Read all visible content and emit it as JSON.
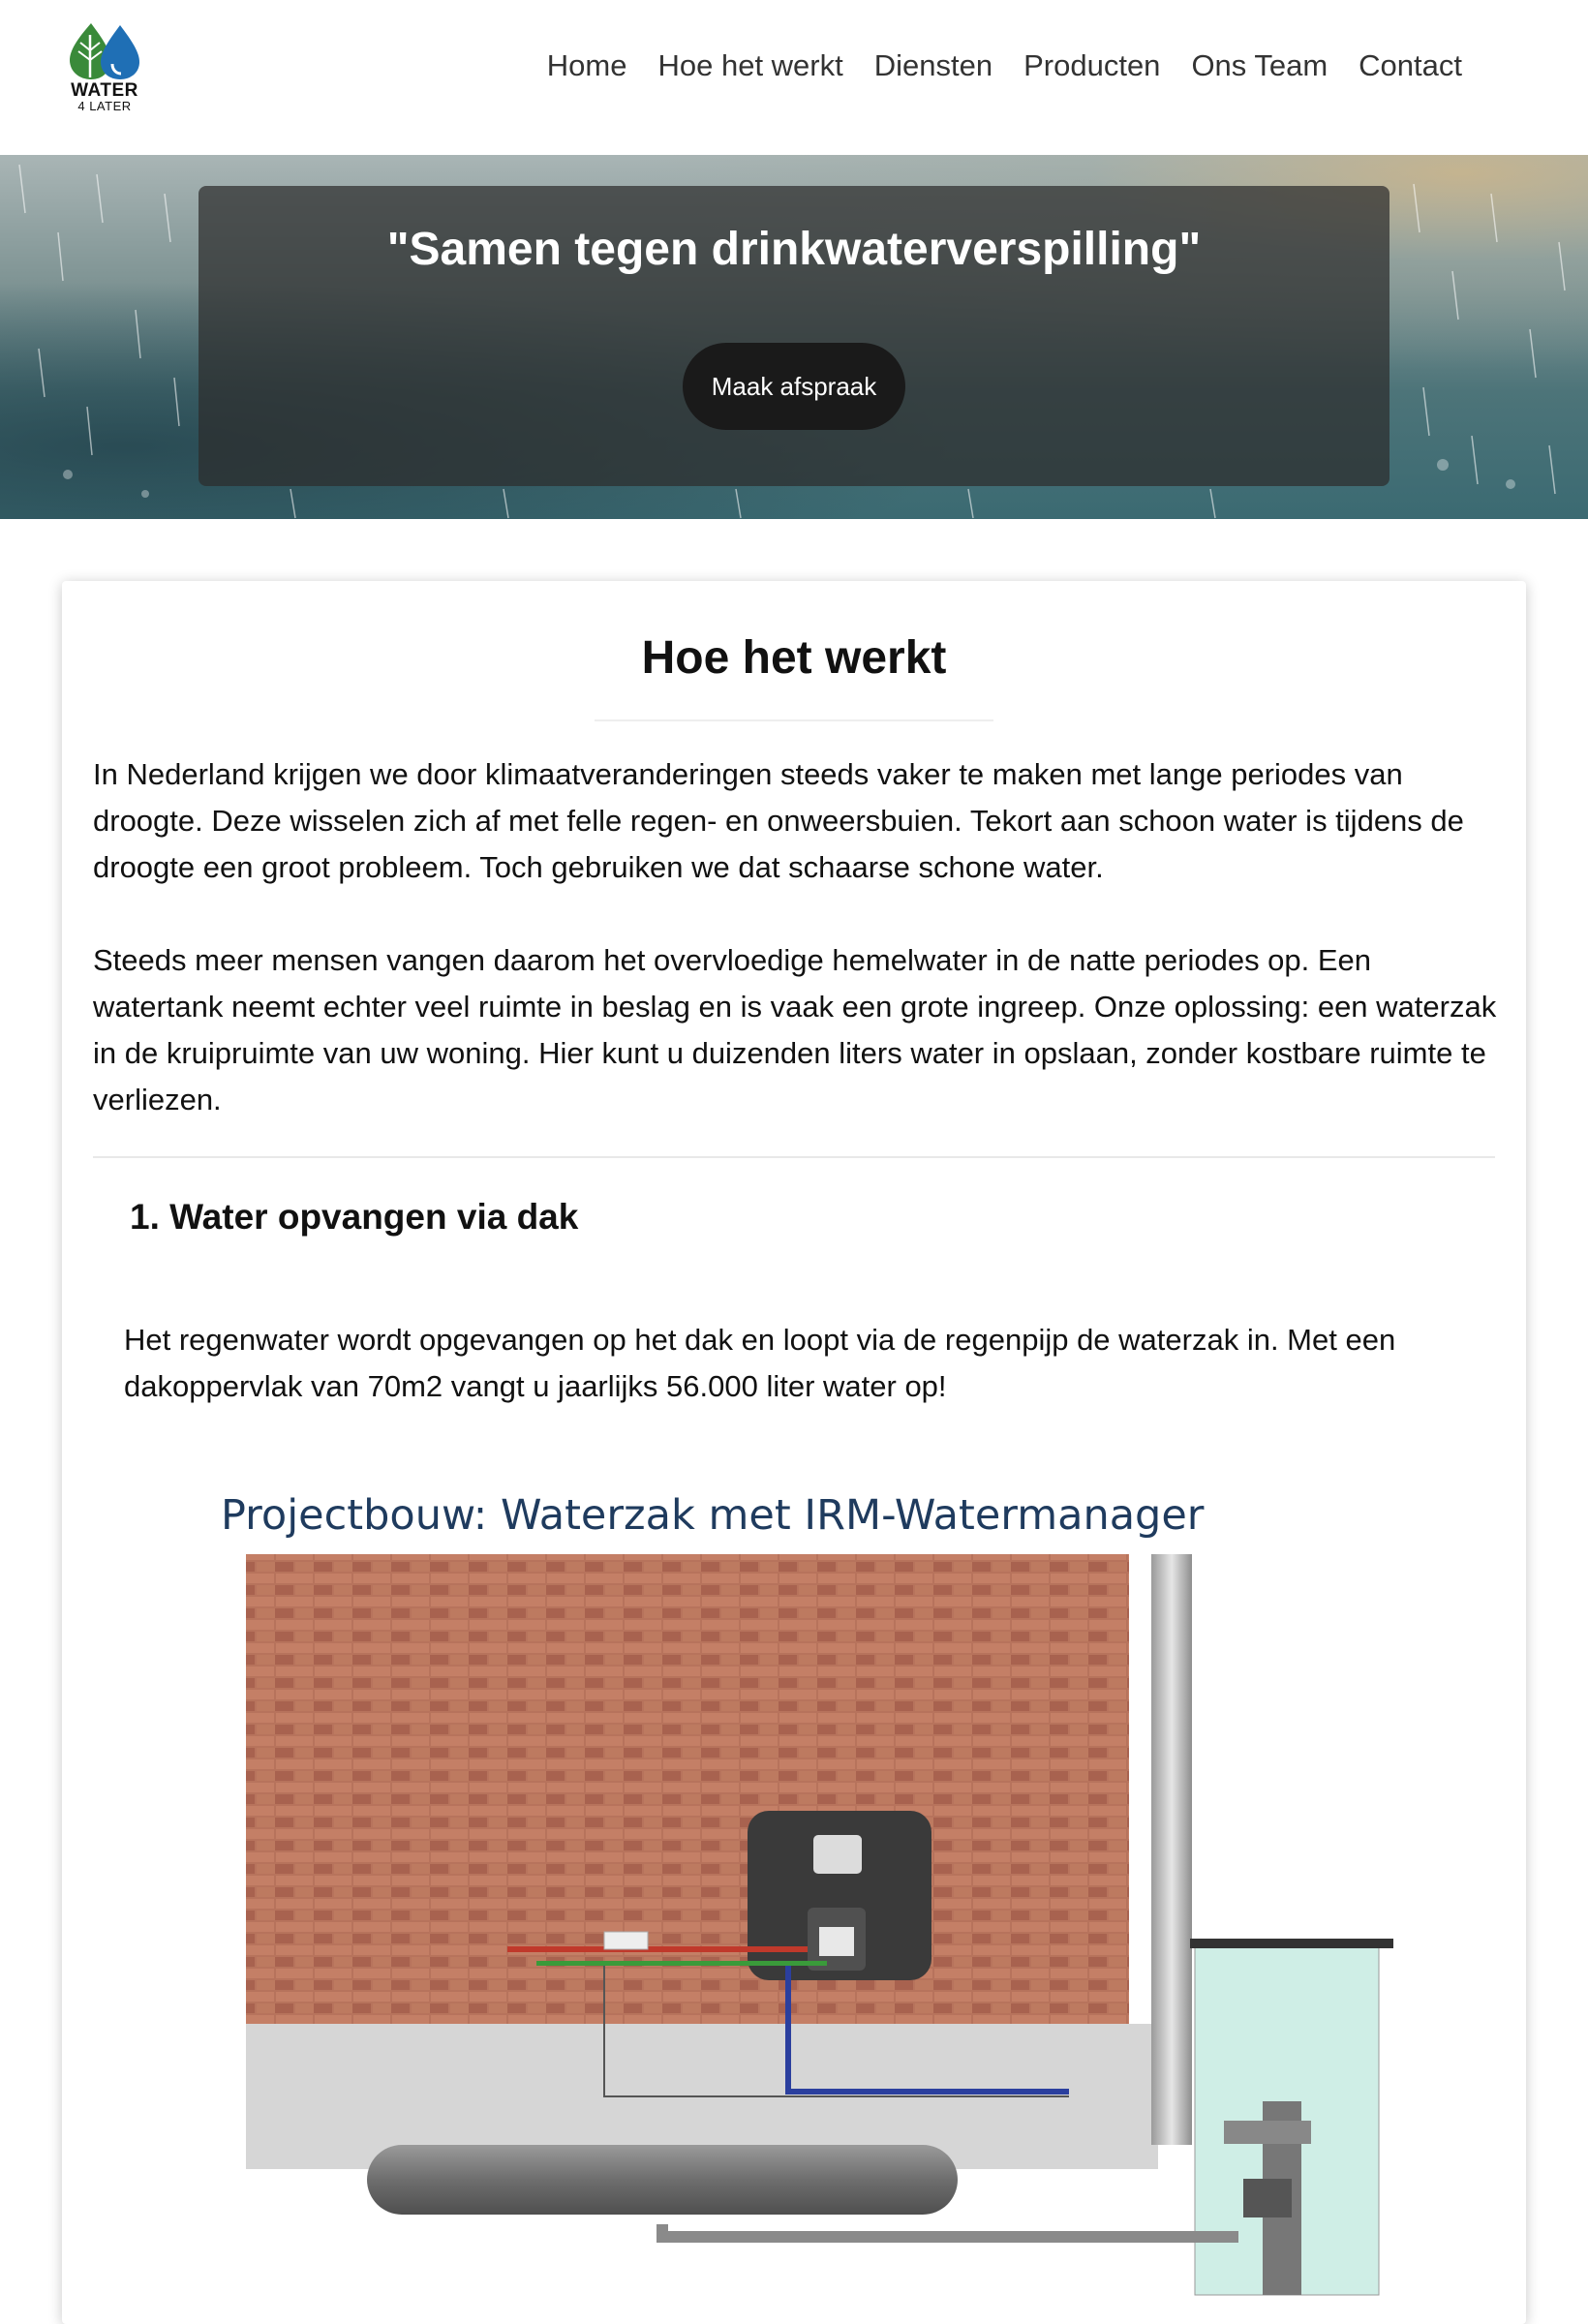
{
  "brand": {
    "logo_line1": "WATER",
    "logo_line2": "4 LATER",
    "leaf_color": "#3a8a3a",
    "drop_color": "#1f6fb5"
  },
  "nav": {
    "items": [
      "Home",
      "Hoe het werkt",
      "Diensten",
      "Producten",
      "Ons Team",
      "Contact"
    ]
  },
  "hero": {
    "quote": "\"Samen tegen drinkwaterverspilling\"",
    "cta_label": "Maak afspraak"
  },
  "section": {
    "title": "Hoe het werkt",
    "paragraph1": "In Nederland krijgen we door klimaatveranderingen steeds vaker te maken met lange periodes van droogte. Deze wisselen zich af met felle regen- en onweersbuien. Tekort aan schoon water is tijdens de droogte een groot probleem. Toch gebruiken we dat schaarse schone water.",
    "paragraph2": "Steeds meer mensen vangen daarom het overvloedige hemelwater in de natte periodes op. Een watertank neemt echter veel ruimte in beslag en is vaak een grote ingreep. Onze oplossing: een waterzak in de kruipruimte van uw woning. Hier kunt u duizenden liters water in opslaan, zonder kostbare ruimte te verliezen.",
    "step1_title": "1. Water opvangen via dak",
    "step1_text": "Het regenwater wordt opgevangen op het dak en loopt via de regenpijp de waterzak in. Met een dakoppervlak van 70m2 vangt u jaarlijks 56.000 liter water op!"
  },
  "figure": {
    "title": "Projectbouw: Waterzak met IRM-Watermanager"
  }
}
